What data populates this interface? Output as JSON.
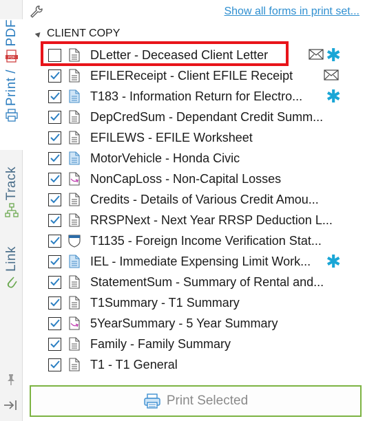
{
  "sidebar": {
    "tabs": [
      {
        "label": "PDF"
      },
      {
        "label": "Print /"
      },
      {
        "label": "Track"
      },
      {
        "label": "Link"
      }
    ]
  },
  "header": {
    "show_all_link": "Show all forms in print set..."
  },
  "group": {
    "title": "CLIENT COPY"
  },
  "forms": [
    {
      "label": "DLetter - Deceased Client Letter",
      "checked": false,
      "icon": "document-icon",
      "envelope": true,
      "star": true,
      "highlighted": true
    },
    {
      "label": "EFILEReceipt - Client EFILE Receipt",
      "checked": true,
      "icon": "document-icon",
      "envelope": true,
      "star": false
    },
    {
      "label": "T183 - Information Return for Electro...",
      "checked": true,
      "icon": "blue-document-icon",
      "envelope": false,
      "star": true
    },
    {
      "label": "DepCredSum - Dependant Credit Summ...",
      "checked": true,
      "icon": "document-icon",
      "envelope": false,
      "star": false
    },
    {
      "label": "EFILEWS - EFILE Worksheet",
      "checked": true,
      "icon": "document-icon",
      "envelope": false,
      "star": false
    },
    {
      "label": "MotorVehicle - Honda Civic",
      "checked": true,
      "icon": "blue-document-icon",
      "envelope": false,
      "star": false
    },
    {
      "label": "NonCapLoss - Non-Capital Losses",
      "checked": true,
      "icon": "pink-arrow-document-icon",
      "envelope": false,
      "star": false
    },
    {
      "label": "Credits - Details of Various Credit Amou...",
      "checked": true,
      "icon": "document-icon",
      "envelope": false,
      "star": false
    },
    {
      "label": "RRSPNext - Next Year RRSP Deduction L...",
      "checked": true,
      "icon": "document-icon",
      "envelope": false,
      "star": false
    },
    {
      "label": "T1135 - Foreign Income Verification Stat...",
      "checked": true,
      "icon": "shield-form-icon",
      "envelope": false,
      "star": false
    },
    {
      "label": "IEL - Immediate Expensing Limit Work...",
      "checked": true,
      "icon": "blue-document-icon",
      "envelope": false,
      "star": true
    },
    {
      "label": "StatementSum - Summary of Rental and...",
      "checked": true,
      "icon": "document-icon",
      "envelope": false,
      "star": false
    },
    {
      "label": "T1Summary - T1 Summary",
      "checked": true,
      "icon": "document-icon",
      "envelope": false,
      "star": false
    },
    {
      "label": "5YearSummary - 5 Year Summary",
      "checked": true,
      "icon": "pink-arrow-document-icon",
      "envelope": false,
      "star": false
    },
    {
      "label": "Family - Family Summary",
      "checked": true,
      "icon": "document-icon",
      "envelope": false,
      "star": false
    },
    {
      "label": "T1 - T1 General",
      "checked": true,
      "icon": "document-icon",
      "envelope": false,
      "star": false
    }
  ],
  "footer": {
    "print_button": "Print Selected"
  },
  "colors": {
    "accent_blue": "#2f8fd0",
    "star": "#1aa6d6",
    "highlight": "#e8141a",
    "button_border": "#7cb342"
  }
}
